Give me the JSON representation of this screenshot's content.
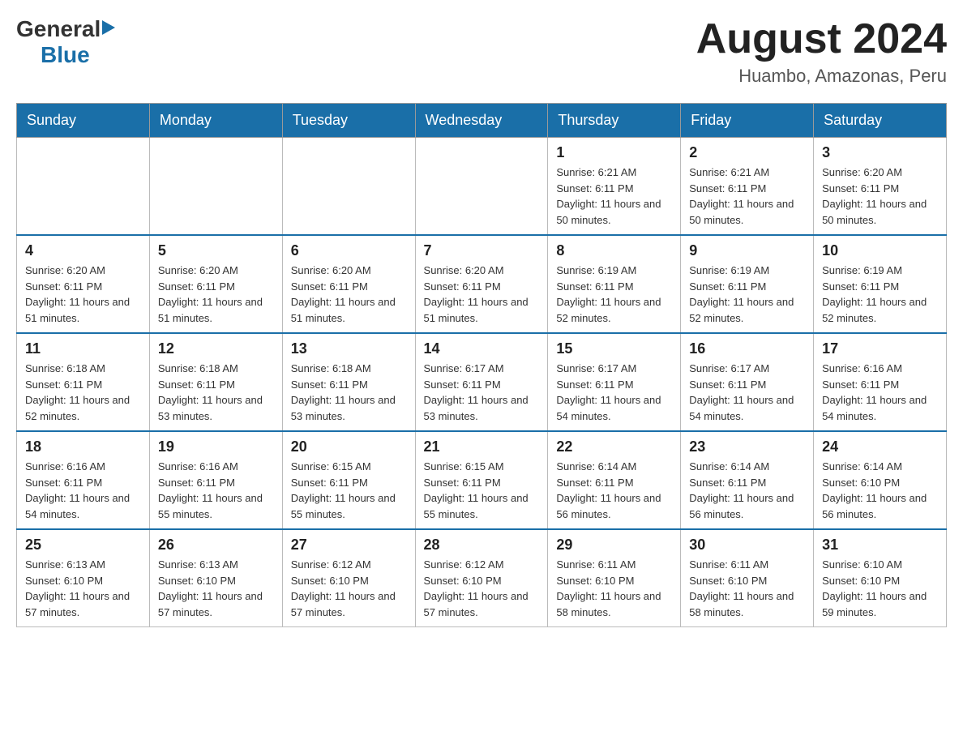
{
  "logo": {
    "general": "General",
    "blue": "Blue"
  },
  "title": {
    "month_year": "August 2024",
    "location": "Huambo, Amazonas, Peru"
  },
  "days_of_week": [
    "Sunday",
    "Monday",
    "Tuesday",
    "Wednesday",
    "Thursday",
    "Friday",
    "Saturday"
  ],
  "weeks": [
    {
      "days": [
        {
          "date": "",
          "sunrise": "",
          "sunset": "",
          "daylight": ""
        },
        {
          "date": "",
          "sunrise": "",
          "sunset": "",
          "daylight": ""
        },
        {
          "date": "",
          "sunrise": "",
          "sunset": "",
          "daylight": ""
        },
        {
          "date": "",
          "sunrise": "",
          "sunset": "",
          "daylight": ""
        },
        {
          "date": "1",
          "sunrise": "Sunrise: 6:21 AM",
          "sunset": "Sunset: 6:11 PM",
          "daylight": "Daylight: 11 hours and 50 minutes."
        },
        {
          "date": "2",
          "sunrise": "Sunrise: 6:21 AM",
          "sunset": "Sunset: 6:11 PM",
          "daylight": "Daylight: 11 hours and 50 minutes."
        },
        {
          "date": "3",
          "sunrise": "Sunrise: 6:20 AM",
          "sunset": "Sunset: 6:11 PM",
          "daylight": "Daylight: 11 hours and 50 minutes."
        }
      ]
    },
    {
      "days": [
        {
          "date": "4",
          "sunrise": "Sunrise: 6:20 AM",
          "sunset": "Sunset: 6:11 PM",
          "daylight": "Daylight: 11 hours and 51 minutes."
        },
        {
          "date": "5",
          "sunrise": "Sunrise: 6:20 AM",
          "sunset": "Sunset: 6:11 PM",
          "daylight": "Daylight: 11 hours and 51 minutes."
        },
        {
          "date": "6",
          "sunrise": "Sunrise: 6:20 AM",
          "sunset": "Sunset: 6:11 PM",
          "daylight": "Daylight: 11 hours and 51 minutes."
        },
        {
          "date": "7",
          "sunrise": "Sunrise: 6:20 AM",
          "sunset": "Sunset: 6:11 PM",
          "daylight": "Daylight: 11 hours and 51 minutes."
        },
        {
          "date": "8",
          "sunrise": "Sunrise: 6:19 AM",
          "sunset": "Sunset: 6:11 PM",
          "daylight": "Daylight: 11 hours and 52 minutes."
        },
        {
          "date": "9",
          "sunrise": "Sunrise: 6:19 AM",
          "sunset": "Sunset: 6:11 PM",
          "daylight": "Daylight: 11 hours and 52 minutes."
        },
        {
          "date": "10",
          "sunrise": "Sunrise: 6:19 AM",
          "sunset": "Sunset: 6:11 PM",
          "daylight": "Daylight: 11 hours and 52 minutes."
        }
      ]
    },
    {
      "days": [
        {
          "date": "11",
          "sunrise": "Sunrise: 6:18 AM",
          "sunset": "Sunset: 6:11 PM",
          "daylight": "Daylight: 11 hours and 52 minutes."
        },
        {
          "date": "12",
          "sunrise": "Sunrise: 6:18 AM",
          "sunset": "Sunset: 6:11 PM",
          "daylight": "Daylight: 11 hours and 53 minutes."
        },
        {
          "date": "13",
          "sunrise": "Sunrise: 6:18 AM",
          "sunset": "Sunset: 6:11 PM",
          "daylight": "Daylight: 11 hours and 53 minutes."
        },
        {
          "date": "14",
          "sunrise": "Sunrise: 6:17 AM",
          "sunset": "Sunset: 6:11 PM",
          "daylight": "Daylight: 11 hours and 53 minutes."
        },
        {
          "date": "15",
          "sunrise": "Sunrise: 6:17 AM",
          "sunset": "Sunset: 6:11 PM",
          "daylight": "Daylight: 11 hours and 54 minutes."
        },
        {
          "date": "16",
          "sunrise": "Sunrise: 6:17 AM",
          "sunset": "Sunset: 6:11 PM",
          "daylight": "Daylight: 11 hours and 54 minutes."
        },
        {
          "date": "17",
          "sunrise": "Sunrise: 6:16 AM",
          "sunset": "Sunset: 6:11 PM",
          "daylight": "Daylight: 11 hours and 54 minutes."
        }
      ]
    },
    {
      "days": [
        {
          "date": "18",
          "sunrise": "Sunrise: 6:16 AM",
          "sunset": "Sunset: 6:11 PM",
          "daylight": "Daylight: 11 hours and 54 minutes."
        },
        {
          "date": "19",
          "sunrise": "Sunrise: 6:16 AM",
          "sunset": "Sunset: 6:11 PM",
          "daylight": "Daylight: 11 hours and 55 minutes."
        },
        {
          "date": "20",
          "sunrise": "Sunrise: 6:15 AM",
          "sunset": "Sunset: 6:11 PM",
          "daylight": "Daylight: 11 hours and 55 minutes."
        },
        {
          "date": "21",
          "sunrise": "Sunrise: 6:15 AM",
          "sunset": "Sunset: 6:11 PM",
          "daylight": "Daylight: 11 hours and 55 minutes."
        },
        {
          "date": "22",
          "sunrise": "Sunrise: 6:14 AM",
          "sunset": "Sunset: 6:11 PM",
          "daylight": "Daylight: 11 hours and 56 minutes."
        },
        {
          "date": "23",
          "sunrise": "Sunrise: 6:14 AM",
          "sunset": "Sunset: 6:11 PM",
          "daylight": "Daylight: 11 hours and 56 minutes."
        },
        {
          "date": "24",
          "sunrise": "Sunrise: 6:14 AM",
          "sunset": "Sunset: 6:10 PM",
          "daylight": "Daylight: 11 hours and 56 minutes."
        }
      ]
    },
    {
      "days": [
        {
          "date": "25",
          "sunrise": "Sunrise: 6:13 AM",
          "sunset": "Sunset: 6:10 PM",
          "daylight": "Daylight: 11 hours and 57 minutes."
        },
        {
          "date": "26",
          "sunrise": "Sunrise: 6:13 AM",
          "sunset": "Sunset: 6:10 PM",
          "daylight": "Daylight: 11 hours and 57 minutes."
        },
        {
          "date": "27",
          "sunrise": "Sunrise: 6:12 AM",
          "sunset": "Sunset: 6:10 PM",
          "daylight": "Daylight: 11 hours and 57 minutes."
        },
        {
          "date": "28",
          "sunrise": "Sunrise: 6:12 AM",
          "sunset": "Sunset: 6:10 PM",
          "daylight": "Daylight: 11 hours and 57 minutes."
        },
        {
          "date": "29",
          "sunrise": "Sunrise: 6:11 AM",
          "sunset": "Sunset: 6:10 PM",
          "daylight": "Daylight: 11 hours and 58 minutes."
        },
        {
          "date": "30",
          "sunrise": "Sunrise: 6:11 AM",
          "sunset": "Sunset: 6:10 PM",
          "daylight": "Daylight: 11 hours and 58 minutes."
        },
        {
          "date": "31",
          "sunrise": "Sunrise: 6:10 AM",
          "sunset": "Sunset: 6:10 PM",
          "daylight": "Daylight: 11 hours and 59 minutes."
        }
      ]
    }
  ]
}
